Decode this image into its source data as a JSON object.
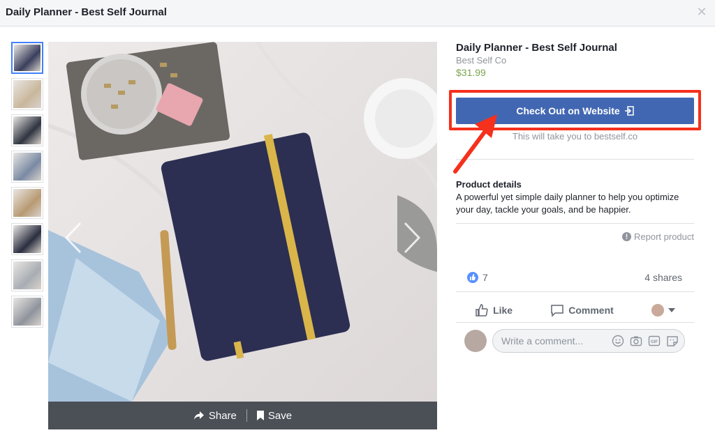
{
  "window": {
    "title": "Daily Planner - Best Self Journal",
    "close_icon": "close-icon"
  },
  "thumbnails": [
    {
      "color": "#3a3f5c",
      "active": true
    },
    {
      "color": "#c9b79c",
      "active": false
    },
    {
      "color": "#2f3440",
      "active": false
    },
    {
      "color": "#7a8aa3",
      "active": false
    },
    {
      "color": "#b89a72",
      "active": false
    },
    {
      "color": "#2a2e3f",
      "active": false
    },
    {
      "color": "#a8adb3",
      "active": false
    },
    {
      "color": "#8f949c",
      "active": false
    }
  ],
  "viewer": {
    "share_label": "Share",
    "save_label": "Save",
    "share_icon": "share-arrow-icon",
    "save_icon": "bookmark-icon"
  },
  "product": {
    "title": "Daily Planner - Best Self Journal",
    "seller": "Best Self Co",
    "price": "$31.99",
    "cta_label": "Check Out on Website",
    "cta_icon": "external-link-icon",
    "cta_note": "This will take you to bestself.co",
    "details_heading": "Product details",
    "details_text": "A powerful yet simple daily planner to help you optimize your day, tackle your goals, and be happier.",
    "report_label": "Report product"
  },
  "engagement": {
    "like_count": "7",
    "shares": "4 shares",
    "like_label": "Like",
    "comment_label": "Comment"
  },
  "comment": {
    "placeholder": "Write a comment..."
  },
  "colors": {
    "brand_blue": "#4267b2",
    "price_green": "#7ba451",
    "annotation_red": "#f5301c"
  }
}
